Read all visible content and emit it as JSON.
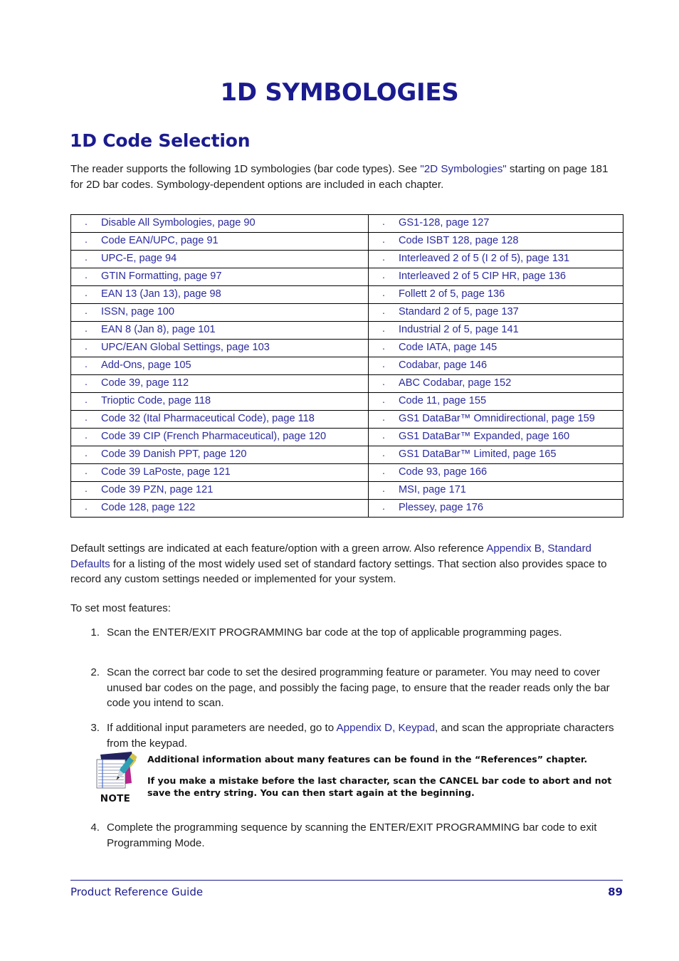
{
  "document": {
    "chapter_title": "1D SYMBOLOGIES",
    "section_heading": "1D Code Selection",
    "colors": {
      "heading": "#1b1b8f",
      "link": "#2b2b9e",
      "body": "#1f1f1f",
      "table_border": "#000000"
    }
  },
  "intro": {
    "part1": "The reader supports the following 1D symbologies (bar code types). See ",
    "link": "\"2D Symbologies\"",
    "part2": " starting on page 181 for 2D bar codes. Symbology-dependent options are included in each chapter."
  },
  "toc_table": {
    "bullet_glyph": "·",
    "rows": [
      {
        "left": "Disable All Symbologies, page 90",
        "right": "GS1-128, page 127"
      },
      {
        "left": "Code EAN/UPC, page 91",
        "right": "Code ISBT 128, page 128"
      },
      {
        "left": "UPC-E, page 94",
        "right": "Interleaved 2 of 5 (I 2 of 5), page 131"
      },
      {
        "left": "GTIN Formatting, page 97",
        "right": "Interleaved 2 of 5 CIP HR, page 136"
      },
      {
        "left": "EAN 13 (Jan 13), page 98",
        "right": "Follett 2 of 5, page 136"
      },
      {
        "left": "ISSN, page 100",
        "right": "Standard 2 of 5, page 137"
      },
      {
        "left": "EAN 8 (Jan 8), page 101",
        "right": "Industrial 2 of 5, page 141"
      },
      {
        "left": "UPC/EAN Global Settings, page 103",
        "right": "Code IATA, page 145"
      },
      {
        "left": "Add-Ons, page 105",
        "right": "Codabar, page 146"
      },
      {
        "left": "Code 39, page 112",
        "right": "ABC Codabar, page 152"
      },
      {
        "left": "Trioptic Code, page 118",
        "right": "Code 11, page 155"
      },
      {
        "left": "Code 32 (Ital Pharmaceutical Code), page 118",
        "right": "GS1 DataBar™ Omnidirectional, page 159"
      },
      {
        "left": "Code 39 CIP (French Pharmaceutical), page 120",
        "right": "GS1 DataBar™ Expanded, page 160"
      },
      {
        "left": "Code 39 Danish PPT, page 120",
        "right": "GS1 DataBar™ Limited, page 165"
      },
      {
        "left": "Code 39 LaPoste, page 121",
        "right": "Code 93, page 166"
      },
      {
        "left": "Code 39 PZN, page 121",
        "right": "MSI, page 171"
      },
      {
        "left": "Code 128, page 122",
        "right": "Plessey, page 176"
      }
    ]
  },
  "body": {
    "defaults_part1": "Default settings are indicated at each feature/option with a green arrow. Also reference ",
    "defaults_link": "Appendix B, Standard Defaults",
    "defaults_part2": " for a listing of the most widely used set of standard factory settings. That section also provides space to record any custom settings needed or implemented for your system.",
    "to_set": "To set most features:"
  },
  "steps": [
    {
      "number": "1.",
      "text": "Scan the ENTER/EXIT PROGRAMMING bar code at the top of applicable programming pages."
    },
    {
      "number": "2.",
      "text": "Scan the correct bar code to set the desired programming feature or parameter. You may need to cover unused bar codes on the page, and possibly the facing page, to ensure that the reader reads only the bar code you intend to scan."
    },
    {
      "number": "3.",
      "text_part1": "If additional input parameters are needed, go to ",
      "link": "Appendix D, Keypad",
      "text_part2": ", and scan the appropriate characters from the keypad."
    },
    {
      "number": "4.",
      "text": "Complete the programming sequence by scanning the ENTER/EXIT PROGRAMMING bar code to exit Programming Mode."
    }
  ],
  "note": {
    "icon_name": "notepad-pen-icon",
    "label": "NOTE",
    "line1": "Additional information about many features can be found in the “References” chapter.",
    "line2": "If you make a mistake before the last character, scan the CANCEL bar code to abort and not save the entry string. You can then start again at the beginning."
  },
  "footer": {
    "left": "Product Reference Guide",
    "page_number": "89"
  }
}
